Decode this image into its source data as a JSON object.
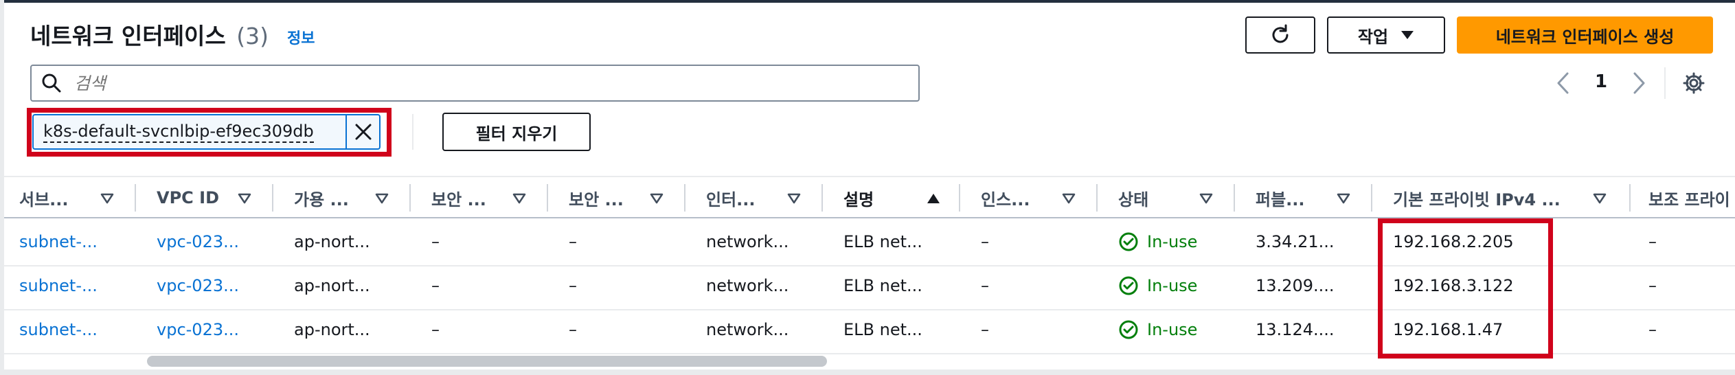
{
  "header": {
    "title": "네트워크 인터페이스",
    "count": "(3)",
    "info_link": "정보",
    "actions_label": "작업",
    "create_label": "네트워크 인터페이스 생성"
  },
  "search": {
    "placeholder": "검색"
  },
  "pagination": {
    "current_page": "1"
  },
  "filter": {
    "token_label": "k8s-default-svcnlbip-ef9ec309db",
    "clear_label": "필터 지우기"
  },
  "table": {
    "columns": [
      {
        "label": "서브..."
      },
      {
        "label": "VPC ID"
      },
      {
        "label": "가용 ..."
      },
      {
        "label": "보안 ..."
      },
      {
        "label": "보안 ..."
      },
      {
        "label": "인터..."
      },
      {
        "label": "설명"
      },
      {
        "label": "인스..."
      },
      {
        "label": "상태"
      },
      {
        "label": "퍼블..."
      },
      {
        "label": "기본 프라이빗 IPv4 ..."
      },
      {
        "label": "보조 프라이"
      }
    ],
    "sorted_column": "설명",
    "sort_direction": "ascending",
    "rows": [
      {
        "subnet": "subnet-...",
        "vpc": "vpc-023...",
        "az": "ap-nort...",
        "sg1": "–",
        "sg2": "–",
        "iface": "network...",
        "desc": "ELB net...",
        "instance": "–",
        "status": "In-use",
        "public": "3.34.21...",
        "private_ip": "192.168.2.205",
        "secondary": "–"
      },
      {
        "subnet": "subnet-...",
        "vpc": "vpc-023...",
        "az": "ap-nort...",
        "sg1": "–",
        "sg2": "–",
        "iface": "network...",
        "desc": "ELB net...",
        "instance": "–",
        "status": "In-use",
        "public": "13.209....",
        "private_ip": "192.168.3.122",
        "secondary": "–"
      },
      {
        "subnet": "subnet-...",
        "vpc": "vpc-023...",
        "az": "ap-nort...",
        "sg1": "–",
        "sg2": "–",
        "iface": "network...",
        "desc": "ELB net...",
        "instance": "–",
        "status": "In-use",
        "public": "13.124....",
        "private_ip": "192.168.1.47",
        "secondary": "–"
      }
    ]
  },
  "icons": {
    "refresh": "refresh-icon",
    "caret": "caret-down-icon",
    "search": "search-icon",
    "prev": "chevron-left-icon",
    "next": "chevron-right-icon",
    "settings": "gear-icon",
    "close": "close-icon",
    "status": "check-circle-icon",
    "filter": "filter-triangle-icon",
    "sort_up": "sort-ascending-icon"
  },
  "colors": {
    "link": "#0972d3",
    "primary_button": "#ff9900",
    "success": "#037f0c",
    "highlight": "#d0021b"
  }
}
